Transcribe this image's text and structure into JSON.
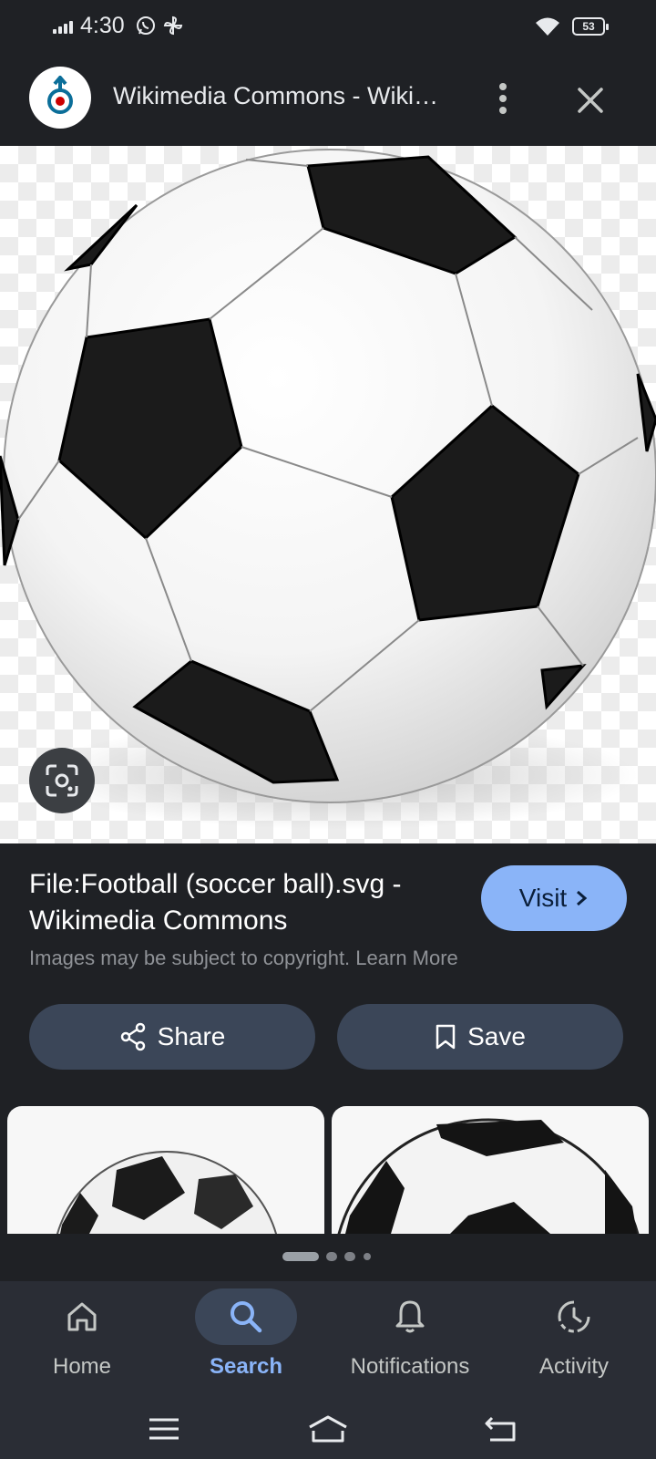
{
  "status_bar": {
    "time": "4:30",
    "icons": [
      "signal-icon",
      "whatsapp-icon",
      "pinwheel-icon",
      "wifi-icon"
    ],
    "battery_level": "53"
  },
  "header": {
    "title": "Wikimedia Commons - Wikimedia Commons",
    "logo": "wikimedia-commons-logo"
  },
  "image": {
    "subject": "soccer-ball"
  },
  "result": {
    "title": "File:Football (soccer ball).svg - Wikimedia Commons",
    "visit_label": "Visit",
    "copyright_text": "Images may be subject to copyright. Learn More"
  },
  "actions": {
    "share_label": "Share",
    "save_label": "Save"
  },
  "pagination": {
    "pages": 4,
    "active_index": 0
  },
  "bottom_nav": {
    "items": [
      {
        "label": "Home",
        "icon": "home-icon",
        "active": false
      },
      {
        "label": "Search",
        "icon": "search-icon",
        "active": true
      },
      {
        "label": "Notifications",
        "icon": "bell-icon",
        "active": false
      },
      {
        "label": "Activity",
        "icon": "activity-icon",
        "active": false
      }
    ]
  },
  "colors": {
    "background": "#1f2125",
    "accent": "#8ab4f8",
    "button_bg": "#3b4658",
    "nav_bg": "#2a2d35"
  }
}
